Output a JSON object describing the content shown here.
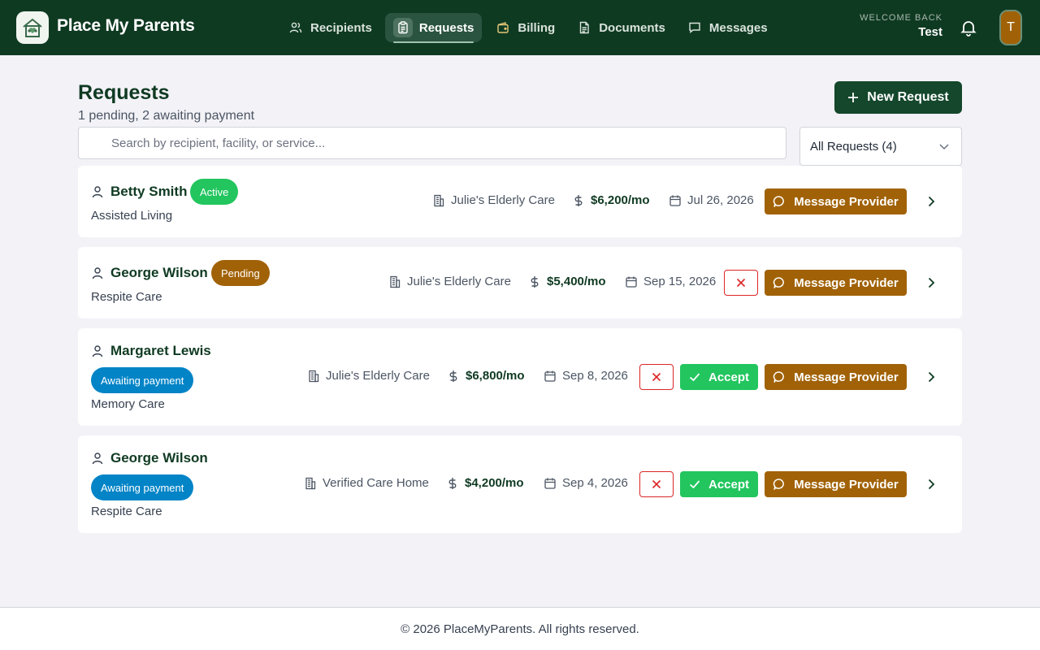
{
  "app": {
    "brand": "Place My Parents"
  },
  "nav": [
    {
      "label": "Recipients",
      "icon": "users-icon"
    },
    {
      "label": "Requests",
      "icon": "clipboard-icon",
      "active": true
    },
    {
      "label": "Billing",
      "icon": "wallet-icon"
    },
    {
      "label": "Documents",
      "icon": "document-icon"
    },
    {
      "label": "Messages",
      "icon": "chat-icon"
    }
  ],
  "user": {
    "welcome_label": "WELCOME BACK",
    "name": "Test",
    "initial": "T"
  },
  "page": {
    "title": "Requests",
    "subtitle": "1 pending, 2 awaiting payment",
    "new_button": "New Request",
    "search_placeholder": "Search by recipient, facility, or service...",
    "filter_value": "All Requests (4)"
  },
  "requests": [
    {
      "name": "Betty Smith",
      "status": "Active",
      "status_color": "#22c55e",
      "care_type": "Assisted Living",
      "facility": "Julie's Elderly Care",
      "price": "$6,200/mo",
      "date": "Jul 26, 2026",
      "message_label": "Message Provider"
    },
    {
      "name": "George Wilson",
      "status": "Pending",
      "status_color": "#a16207",
      "care_type": "Respite Care",
      "facility": "Julie's Elderly Care",
      "price": "$5,400/mo",
      "date": "Sep 15, 2026",
      "message_label": "Message Provider"
    },
    {
      "name": "Margaret Lewis",
      "status": "Awaiting payment",
      "status_color": "#0284c7",
      "care_type": "Memory Care",
      "facility": "Julie's Elderly Care",
      "price": "$6,800/mo",
      "date": "Sep 8, 2026",
      "accept_label": "Accept",
      "message_label": "Message Provider"
    },
    {
      "name": "George Wilson",
      "status": "Awaiting payment",
      "status_color": "#0284c7",
      "care_type": "Respite Care",
      "facility": "Verified Care Home",
      "price": "$4,200/mo",
      "date": "Sep 4, 2026",
      "accept_label": "Accept",
      "message_label": "Message Provider"
    }
  ],
  "footer": {
    "text": "© 2026 PlaceMyParents. All rights reserved."
  },
  "colors": {
    "header_bg": "#0f3a22",
    "accent_gold": "#a16207",
    "accept_green": "#22c55e",
    "awaiting_blue": "#0284c7"
  }
}
